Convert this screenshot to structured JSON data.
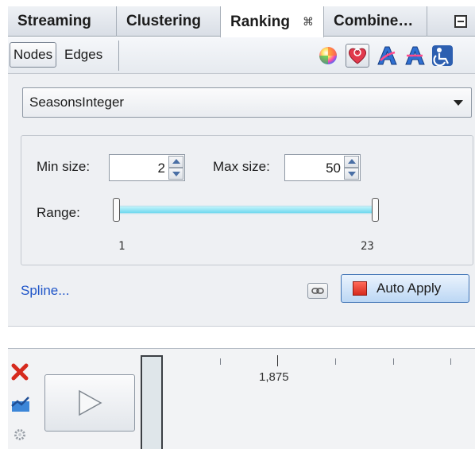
{
  "tabs": [
    {
      "label": "Streaming",
      "active": false
    },
    {
      "label": "Clustering",
      "active": false
    },
    {
      "label": "Ranking",
      "active": true,
      "close_glyph": "⌘"
    },
    {
      "label": "Combine…",
      "active": false
    }
  ],
  "subbar": {
    "nodes_label": "Nodes",
    "edges_label": "Edges",
    "icons": [
      "color-wheel-icon",
      "size-heart-icon",
      "label-color-icon",
      "label-size-icon",
      "transform-icon"
    ]
  },
  "ranking": {
    "attribute": "SeasonsInteger",
    "min_size_label": "Min size:",
    "min_size_value": "2",
    "max_size_label": "Max size:",
    "max_size_value": "50",
    "range_label": "Range:",
    "range_min": "1",
    "range_max": "23",
    "range_low_fraction": 0,
    "range_high_fraction": 1
  },
  "footer": {
    "spline_link": "Spline...",
    "auto_apply_label": "Auto Apply"
  },
  "timeline": {
    "tick_label": "1,875"
  },
  "colors": {
    "accent": "#3f73b5",
    "range_track": "#6fd8ee",
    "link": "#1f55c8",
    "close_red": "#d62a1d"
  }
}
